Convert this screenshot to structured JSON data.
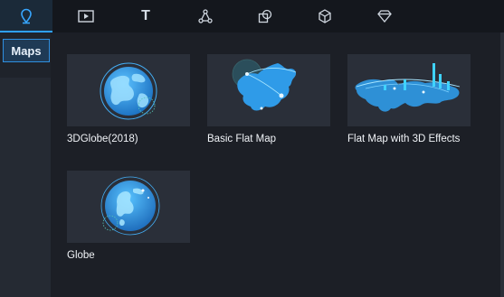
{
  "toolbar": {
    "tabs": [
      {
        "icon": "map-pin-icon",
        "active": true
      },
      {
        "icon": "video-icon",
        "active": false
      },
      {
        "icon": "text-icon",
        "active": false
      },
      {
        "icon": "network-icon",
        "active": false
      },
      {
        "icon": "shapes-icon",
        "active": false
      },
      {
        "icon": "cube-icon",
        "active": false
      },
      {
        "icon": "diamond-icon",
        "active": false
      }
    ],
    "text_icon_glyph": "T"
  },
  "sidebar": {
    "category_label": "Maps"
  },
  "gallery": {
    "items": [
      {
        "label": "3DGlobe(2018)",
        "thumbnail_icon": "globe-icon"
      },
      {
        "label": "Basic Flat Map",
        "thumbnail_icon": "china-map-icon"
      },
      {
        "label": "Flat Map with 3D Effects",
        "thumbnail_icon": "world-3d-map-icon"
      },
      {
        "label": "Globe",
        "thumbnail_icon": "globe-icon"
      }
    ]
  },
  "colors": {
    "accent": "#2fa0ff",
    "toolbar_bg": "#14171d",
    "card_bg": "#2a2f39",
    "globe_blue": "#2f9be8"
  }
}
